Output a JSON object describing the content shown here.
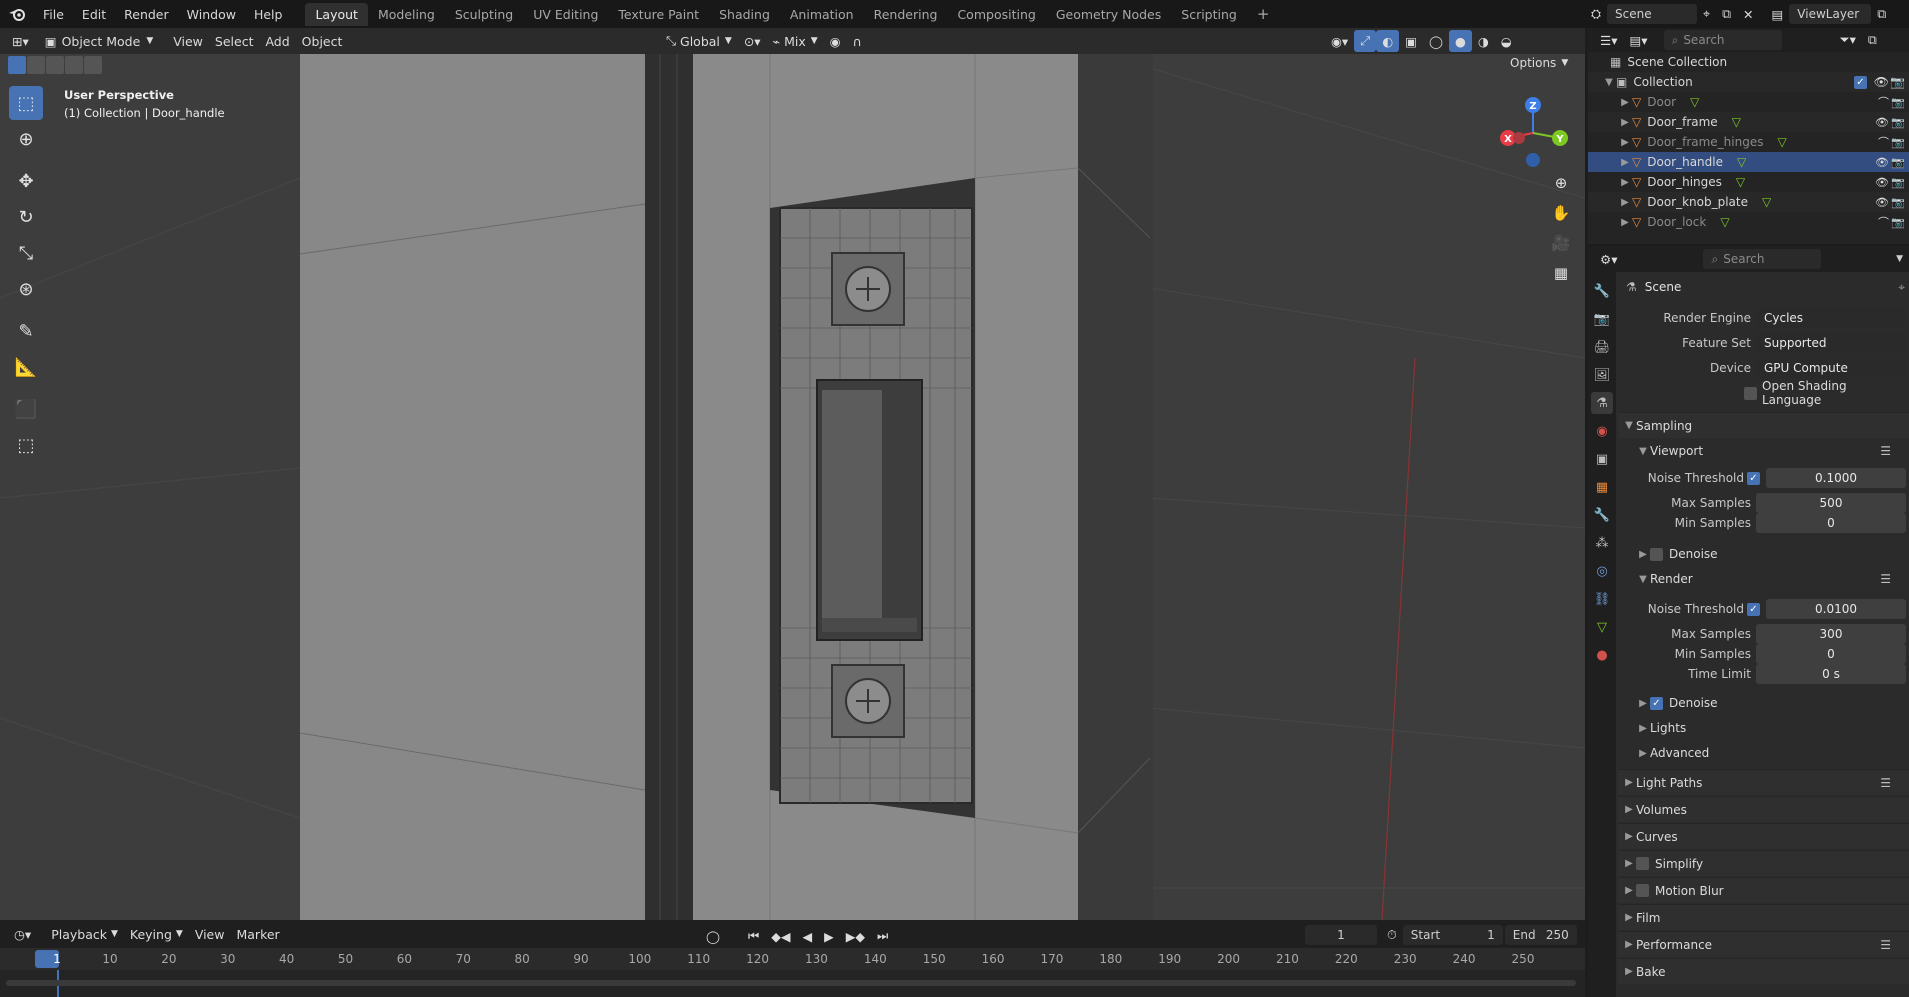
{
  "menus": [
    "File",
    "Edit",
    "Render",
    "Window",
    "Help"
  ],
  "workspaces": [
    "Layout",
    "Modeling",
    "Sculpting",
    "UV Editing",
    "Texture Paint",
    "Shading",
    "Animation",
    "Rendering",
    "Compositing",
    "Geometry Nodes",
    "Scripting"
  ],
  "active_workspace": "Layout",
  "scene": {
    "label": "Scene",
    "viewlayer": "ViewLayer"
  },
  "viewport": {
    "mode": "Object Mode",
    "menus": [
      "View",
      "Select",
      "Add",
      "Object"
    ],
    "orientation": "Global",
    "snap_mode": "Mix",
    "options": "Options",
    "perspective": "User Perspective",
    "context": "(1) Collection | Door_handle",
    "gizmo": {
      "x": "X",
      "y": "Y",
      "z": "Z"
    }
  },
  "timeline": {
    "menus": [
      "Playback",
      "Keying",
      "View",
      "Marker"
    ],
    "current_frame": "1",
    "start_label": "Start",
    "start": "1",
    "end_label": "End",
    "end": "250",
    "ticks": [
      "1",
      "10",
      "20",
      "30",
      "40",
      "50",
      "60",
      "70",
      "80",
      "90",
      "100",
      "110",
      "120",
      "130",
      "140",
      "150",
      "160",
      "170",
      "180",
      "190",
      "200",
      "210",
      "220",
      "230",
      "240",
      "250"
    ]
  },
  "outliner": {
    "search_placeholder": "Search",
    "root": "Scene Collection",
    "collection": "Collection",
    "items": [
      {
        "name": "Door",
        "state": "hidden"
      },
      {
        "name": "Door_frame",
        "state": "visible"
      },
      {
        "name": "Door_frame_hinges",
        "state": "hidden"
      },
      {
        "name": "Door_handle",
        "state": "selected"
      },
      {
        "name": "Door_hinges",
        "state": "visible"
      },
      {
        "name": "Door_knob_plate",
        "state": "visible"
      },
      {
        "name": "Door_lock",
        "state": "hidden"
      }
    ]
  },
  "properties": {
    "search_placeholder": "Search",
    "context": "Scene",
    "render_engine": {
      "label": "Render Engine",
      "value": "Cycles"
    },
    "feature_set": {
      "label": "Feature Set",
      "value": "Supported"
    },
    "device": {
      "label": "Device",
      "value": "GPU Compute"
    },
    "osl": "Open Shading Language",
    "sampling": "Sampling",
    "viewport": {
      "label": "Viewport",
      "noise_threshold": {
        "label": "Noise Threshold",
        "value": "0.1000"
      },
      "max_samples": {
        "label": "Max Samples",
        "value": "500"
      },
      "min_samples": {
        "label": "Min Samples",
        "value": "0"
      },
      "denoise": "Denoise"
    },
    "render": {
      "label": "Render",
      "noise_threshold": {
        "label": "Noise Threshold",
        "value": "0.0100"
      },
      "max_samples": {
        "label": "Max Samples",
        "value": "300"
      },
      "min_samples": {
        "label": "Min Samples",
        "value": "0"
      },
      "time_limit": {
        "label": "Time Limit",
        "value": "0 s"
      },
      "denoise": "Denoise"
    },
    "lights": "Lights",
    "advanced": "Advanced",
    "panels": [
      "Light Paths",
      "Volumes",
      "Curves",
      "Simplify",
      "Motion Blur",
      "Film",
      "Performance",
      "Bake"
    ]
  },
  "colors": {
    "accent": "#4772b3",
    "selected_row": "#334d80",
    "axis_x": "#e83c46",
    "axis_y": "#7ec822",
    "axis_z": "#3d7fe6"
  }
}
